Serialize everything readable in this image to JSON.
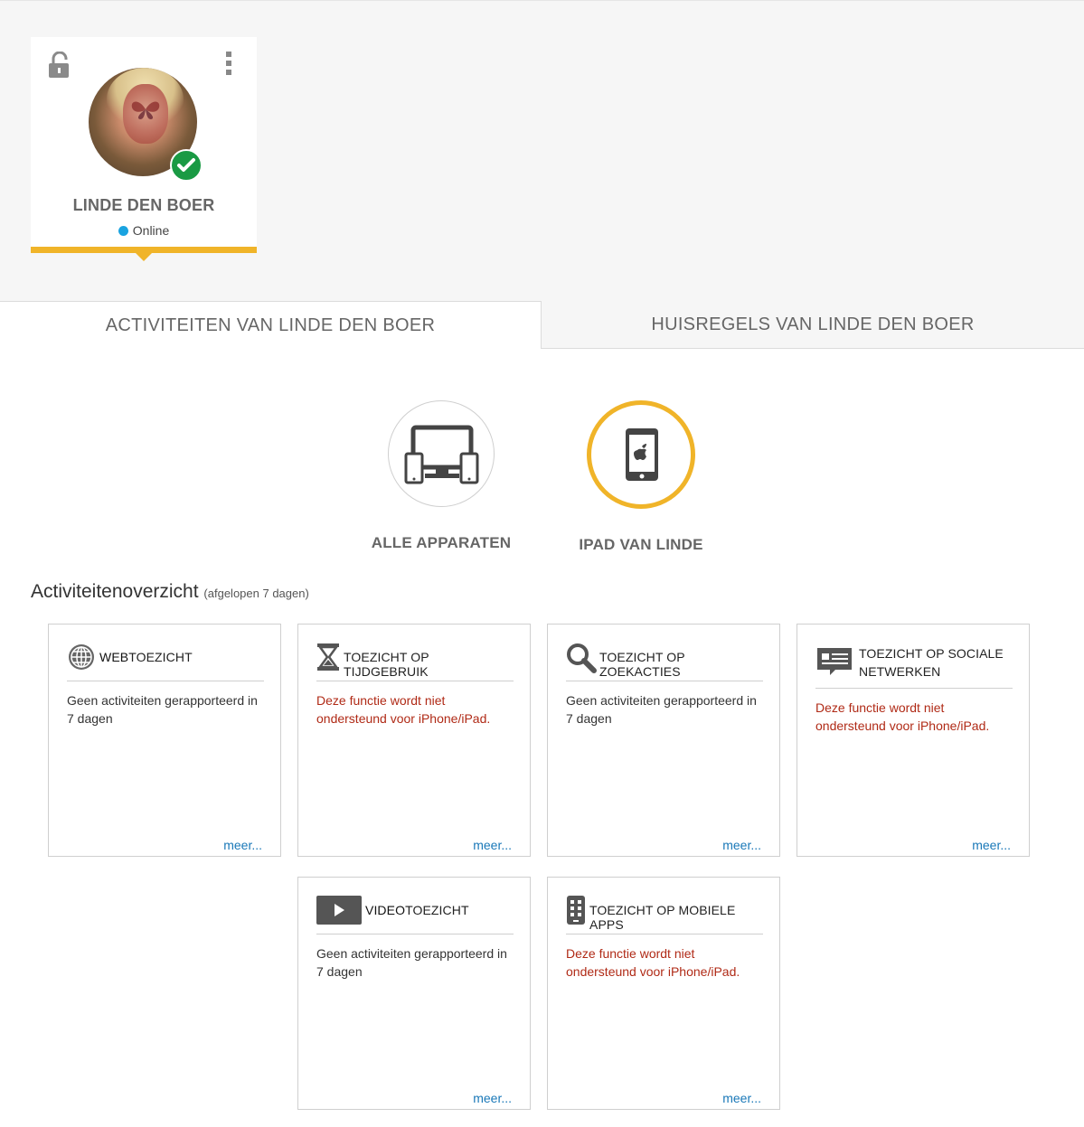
{
  "profile": {
    "name": "LINDE DEN BOER",
    "status": "Online",
    "status_color": "#1aa3e0",
    "accent_color": "#f0b429"
  },
  "tabs": [
    {
      "label": "ACTIVITEITEN VAN LINDE DEN BOER",
      "active": true
    },
    {
      "label": "HUISREGELS VAN LINDE DEN BOER",
      "active": false
    }
  ],
  "devices": [
    {
      "label": "ALLE APPARATEN",
      "icon": "all-devices-icon",
      "selected": false
    },
    {
      "label": "IPAD VAN LINDE",
      "icon": "ipad-icon",
      "selected": true
    }
  ],
  "overview": {
    "title": "Activiteitenoverzicht",
    "subtitle": "(afgelopen 7 dagen)"
  },
  "cards": [
    {
      "title_bold": "WEB",
      "title_rest": "TOEZICHT",
      "body": "Geen activiteiten gerapporteerd in 7 dagen",
      "more": "meer...",
      "icon": "globe-icon"
    },
    {
      "title_bold": "",
      "title_rest": "TOEZICHT OP TIJDGEBRUIK",
      "body": "Deze functie wordt niet ondersteund voor iPhone/iPad.",
      "more": "meer...",
      "icon": "hourglass-icon"
    },
    {
      "title_bold": "",
      "title_rest": "TOEZICHT OP ZOEKACTIES",
      "body": "Geen activiteiten gerapporteerd in 7 dagen",
      "more": "meer...",
      "icon": "search-icon"
    },
    {
      "title_bold": "",
      "title_rest": "TOEZICHT OP SOCIALE NETWERKEN",
      "body": "Deze functie wordt niet ondersteund voor iPhone/iPad.",
      "more": "meer...",
      "icon": "social-network-icon"
    },
    {
      "title_bold": "VIDEO",
      "title_rest": "TOEZICHT",
      "body": "Geen activiteiten gerapporteerd in 7 dagen",
      "more": "meer...",
      "icon": "video-play-icon"
    },
    {
      "title_bold": "",
      "title_rest": "TOEZICHT OP MOBIELE APPS",
      "body": "Deze functie wordt niet ondersteund voor iPhone/iPad.",
      "more": "meer...",
      "icon": "mobile-apps-icon"
    }
  ]
}
